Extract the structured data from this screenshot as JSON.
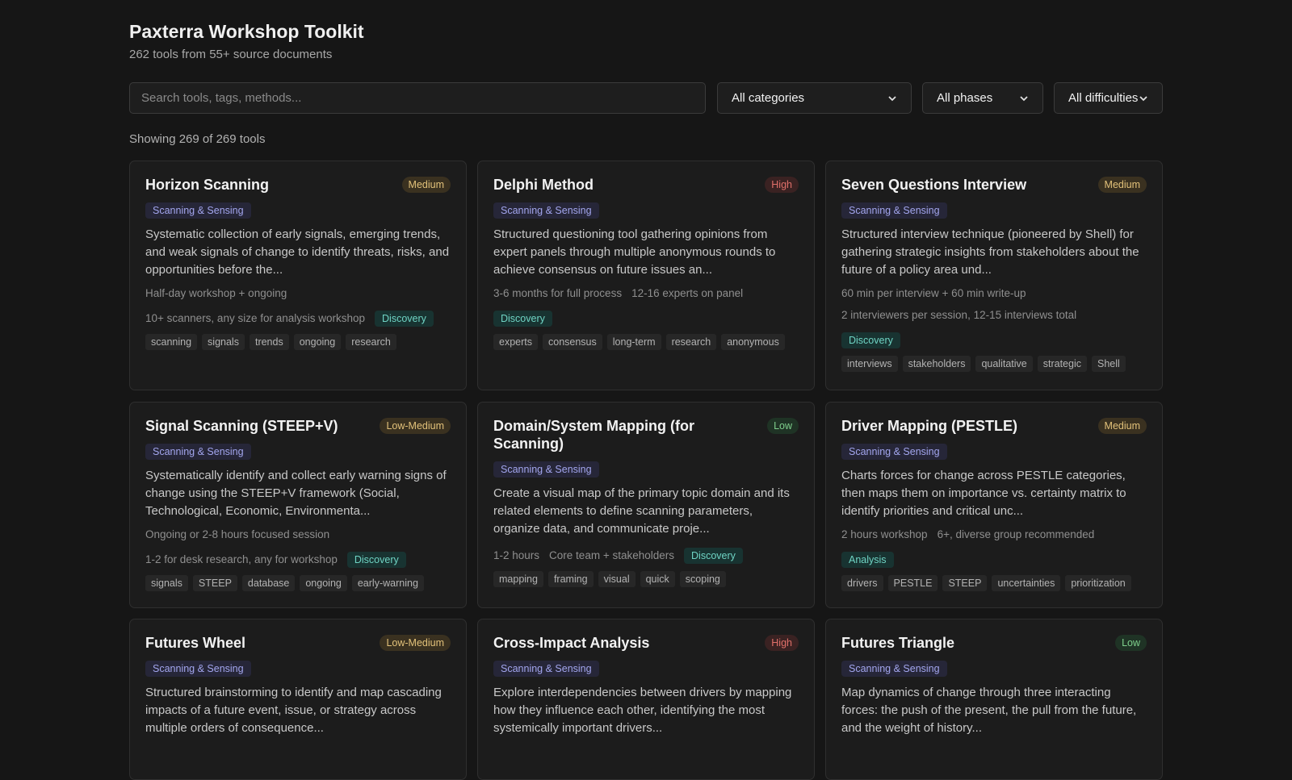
{
  "header": {
    "title": "Paxterra Workshop Toolkit",
    "subtitle": "262 tools from 55+ source documents"
  },
  "filters": {
    "search_placeholder": "Search tools, tags, methods...",
    "category": "All categories",
    "phase": "All phases",
    "difficulty": "All difficulties"
  },
  "results": {
    "showing": "Showing 269 of 269 tools"
  },
  "cards": [
    {
      "title": "Horizon Scanning",
      "difficulty": "Medium",
      "category": "Scanning & Sensing",
      "description": "Systematic collection of early signals, emerging trends, and weak signals of change to identify threats, risks, and opportunities before the...",
      "meta1": "Half-day workshop + ongoing",
      "meta2": "10+ scanners, any size for analysis workshop",
      "phase": "Discovery",
      "tags": [
        "scanning",
        "signals",
        "trends",
        "ongoing",
        "research"
      ]
    },
    {
      "title": "Delphi Method",
      "difficulty": "High",
      "category": "Scanning & Sensing",
      "description": "Structured questioning tool gathering opinions from expert panels through multiple anonymous rounds to achieve consensus on future issues an...",
      "meta1": "3-6 months for full process",
      "meta2": "12-16 experts on panel",
      "phase": "Discovery",
      "tags": [
        "experts",
        "consensus",
        "long-term",
        "research",
        "anonymous"
      ]
    },
    {
      "title": "Seven Questions Interview",
      "difficulty": "Medium",
      "category": "Scanning & Sensing",
      "description": "Structured interview technique (pioneered by Shell) for gathering strategic insights from stakeholders about the future of a policy area und...",
      "meta1": "60 min per interview + 60 min write-up",
      "meta2": "2 interviewers per session, 12-15 interviews total",
      "phase": "Discovery",
      "tags": [
        "interviews",
        "stakeholders",
        "qualitative",
        "strategic",
        "Shell"
      ]
    },
    {
      "title": "Signal Scanning (STEEP+V)",
      "difficulty": "Low-Medium",
      "category": "Scanning & Sensing",
      "description": "Systematically identify and collect early warning signs of change using the STEEP+V framework (Social, Technological, Economic, Environmenta...",
      "meta1": "Ongoing or 2-8 hours focused session",
      "meta2": "1-2 for desk research, any for workshop",
      "phase": "Discovery",
      "tags": [
        "signals",
        "STEEP",
        "database",
        "ongoing",
        "early-warning"
      ]
    },
    {
      "title": "Domain/System Mapping (for Scanning)",
      "difficulty": "Low",
      "category": "Scanning & Sensing",
      "description": "Create a visual map of the primary topic domain and its related elements to define scanning parameters, organize data, and communicate proje...",
      "meta1": "1-2 hours",
      "meta2": "Core team + stakeholders",
      "phase": "Discovery",
      "tags": [
        "mapping",
        "framing",
        "visual",
        "quick",
        "scoping"
      ]
    },
    {
      "title": "Driver Mapping (PESTLE)",
      "difficulty": "Medium",
      "category": "Scanning & Sensing",
      "description": "Charts forces for change across PESTLE categories, then maps them on importance vs. certainty matrix to identify priorities and critical unc...",
      "meta1": "2 hours workshop",
      "meta2": "6+, diverse group recommended",
      "phase": "Analysis",
      "tags": [
        "drivers",
        "PESTLE",
        "STEEP",
        "uncertainties",
        "prioritization"
      ]
    },
    {
      "title": "Futures Wheel",
      "difficulty": "Low-Medium",
      "category": "Scanning & Sensing",
      "description": "Structured brainstorming to identify and map cascading impacts of a future event, issue, or strategy across multiple orders of consequence..."
    },
    {
      "title": "Cross-Impact Analysis",
      "difficulty": "High",
      "category": "Scanning & Sensing",
      "description": "Explore interdependencies between drivers by mapping how they influence each other, identifying the most systemically important drivers..."
    },
    {
      "title": "Futures Triangle",
      "difficulty": "Low",
      "category": "Scanning & Sensing",
      "description": "Map dynamics of change through three interacting forces: the push of the present, the pull from the future, and the weight of history..."
    }
  ]
}
